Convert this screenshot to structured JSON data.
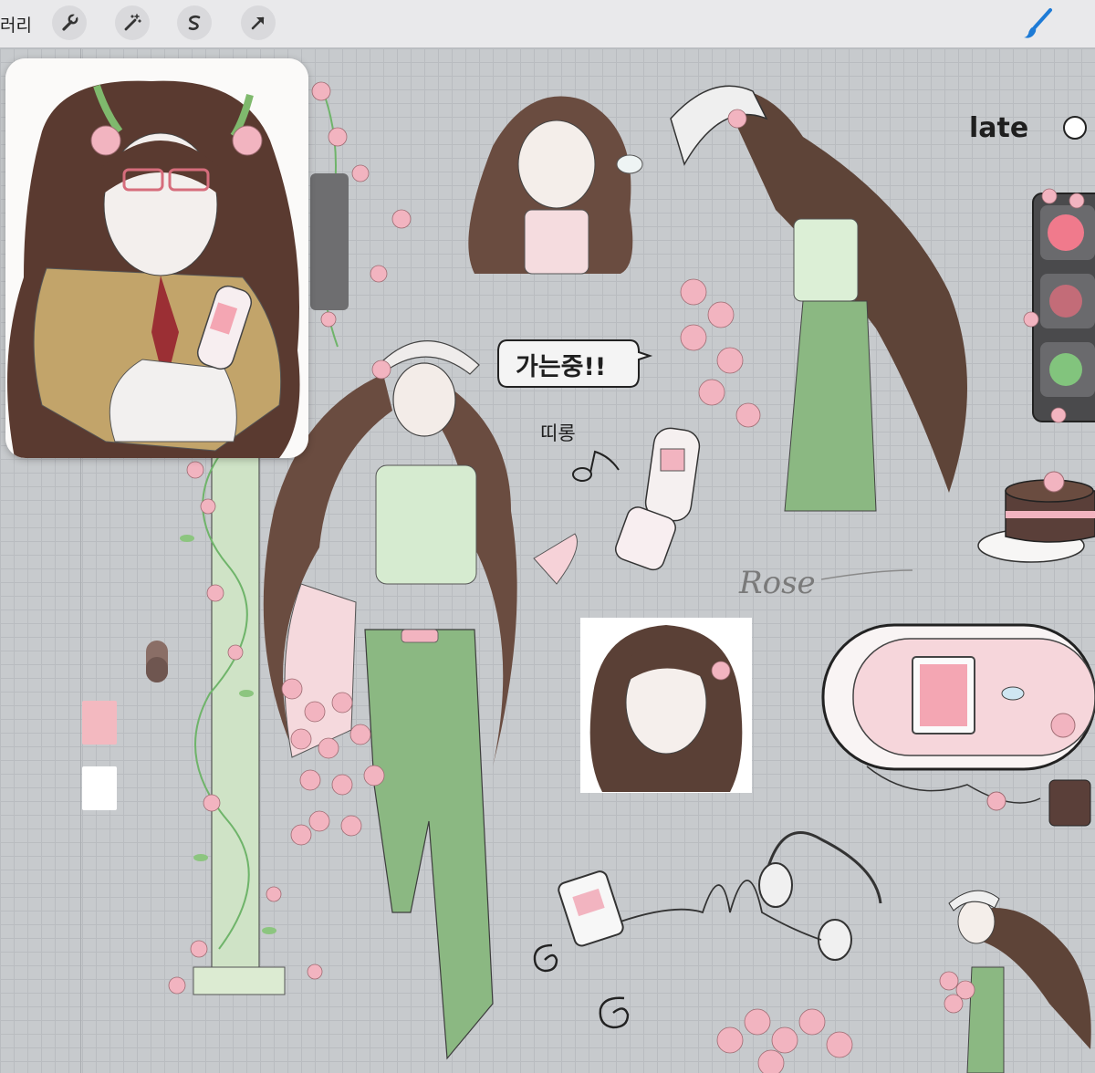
{
  "toolbar": {
    "gallery_label": "러리",
    "tools": [
      {
        "icon": "wrench-icon"
      },
      {
        "icon": "magic-wand-icon"
      },
      {
        "icon": "selection-s-icon"
      },
      {
        "icon": "transform-arrow-icon"
      }
    ],
    "brush_icon": "brush-icon",
    "accent_color": "#1e7bd6"
  },
  "canvas": {
    "background": "#c7cacd",
    "speech_bubble_text": "가는중!!",
    "sound_effect_text": "띠롱",
    "corner_text": "late",
    "signature_text": "Rose"
  },
  "swatches": [
    {
      "color": "#8a6e66"
    },
    {
      "color": "#6f5650"
    },
    {
      "color": "#f3b9c0"
    },
    {
      "color": "#ffffff"
    }
  ],
  "colors": {
    "hair": "#5a4036",
    "pink": "#f2b4c0",
    "green": "#7fa878",
    "leaf": "#6fb46a",
    "outline": "#2a2222"
  }
}
